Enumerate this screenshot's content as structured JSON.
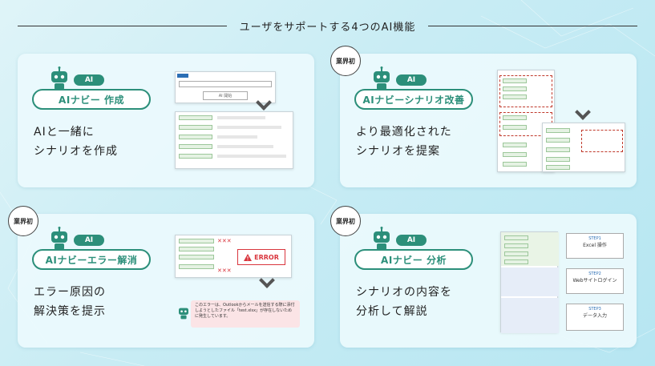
{
  "header": {
    "title": "ユーザをサポートする4つのAI機能"
  },
  "cards": [
    {
      "ai_tag": "AI",
      "pill": "AIナビー 作成",
      "desc": [
        "AIと一緒に",
        "シナリオを作成"
      ],
      "mock_button": "AI 開始"
    },
    {
      "badge": "業界初",
      "ai_tag": "AI",
      "pill": "AIナビーシナリオ改善",
      "desc": [
        "より最適化された",
        "シナリオを提案"
      ]
    },
    {
      "badge": "業界初",
      "ai_tag": "AI",
      "pill": "AIナビーエラー解消",
      "desc": [
        "エラー原因の",
        "解決策を提示"
      ],
      "error_label": "ERROR",
      "error_message": "このエラーは、Outlookからメールを送信する際に添付しようとしたファイル「test.xlsx」が存在しないために発生しています。"
    },
    {
      "badge": "業界初",
      "ai_tag": "AI",
      "pill": "AIナビー 分析",
      "desc": [
        "シナリオの内容を",
        "分析して解説"
      ],
      "steps": [
        {
          "title": "STEP1",
          "name": "Excel 操作"
        },
        {
          "title": "STEP2",
          "name": "Webサイトログイン"
        },
        {
          "title": "STEP3",
          "name": "データ入力"
        }
      ]
    }
  ],
  "colors": {
    "accent": "#2c8f7a",
    "error": "#d9363e",
    "badge_border": "#444444"
  }
}
